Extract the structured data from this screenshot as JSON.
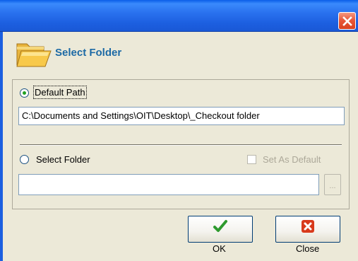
{
  "dialog": {
    "title_bar": {
      "close_icon": "close-x-icon"
    },
    "header": {
      "title": "Select Folder",
      "icon": "open-folder-icon"
    },
    "default_path": {
      "label": "Default Path",
      "selected": true,
      "value": "C:\\Documents and Settings\\OIT\\Desktop\\_Checkout folder"
    },
    "select_folder": {
      "label": "Select Folder",
      "selected": false,
      "value": "",
      "browse_label": "...",
      "set_as_default_label": "Set As Default",
      "set_as_default_checked": false,
      "set_as_default_enabled": false
    },
    "buttons": {
      "ok_label": "OK",
      "ok_icon": "green-checkmark-icon",
      "close_label": "Close",
      "close_icon": "red-x-icon"
    }
  },
  "colors": {
    "title_bar": "#1c5fe0",
    "header_title": "#1d6aa5",
    "window_bg": "#ece9d8",
    "ok_check": "#2e9a2e",
    "close_red": "#d83a1c"
  }
}
